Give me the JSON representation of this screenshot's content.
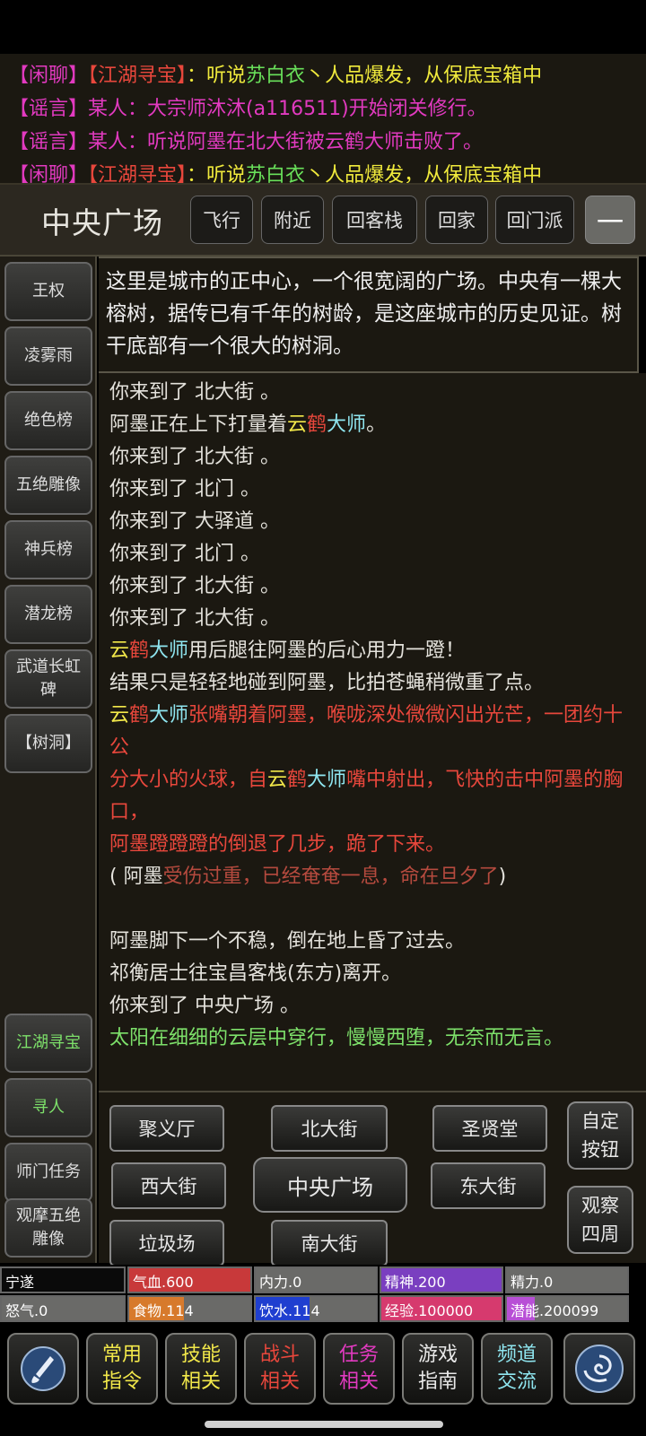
{
  "chat": [
    [
      {
        "t": "【闲聊】",
        "c": "#e23ac0"
      },
      {
        "t": "【江湖寻宝】",
        "c": "#e8473c"
      },
      {
        "t": "：听说",
        "c": "#f0ea3c"
      },
      {
        "t": "苏白衣",
        "c": "#69e05a"
      },
      {
        "t": "丶人品爆发，从保底宝箱中",
        "c": "#f0ea3c"
      }
    ],
    [
      {
        "t": "【谣言】",
        "c": "#e23ac0"
      },
      {
        "t": "某人：大宗师沐沐(a116511)开始闭关修行。",
        "c": "#e23ac0"
      }
    ],
    [
      {
        "t": "【谣言】",
        "c": "#e23ac0"
      },
      {
        "t": "某人：听说阿墨在北大街被云鹤大师击败了。",
        "c": "#e23ac0"
      }
    ],
    [
      {
        "t": "【闲聊】",
        "c": "#e23ac0"
      },
      {
        "t": "【江湖寻宝】",
        "c": "#e8473c"
      },
      {
        "t": "：听说",
        "c": "#f0ea3c"
      },
      {
        "t": "苏白衣",
        "c": "#69e05a"
      },
      {
        "t": "丶人品爆发，从保底宝箱中",
        "c": "#f0ea3c"
      }
    ]
  ],
  "header": {
    "title": "中央广场",
    "buttons": [
      "飞行",
      "附近",
      "回客栈",
      "回家",
      "回门派",
      "一"
    ]
  },
  "sidebar": {
    "items": [
      "王权",
      "凌雾雨",
      "绝色榜",
      "五绝雕像",
      "神兵榜",
      "潜龙榜",
      "武道长虹碑",
      "【树洞】"
    ],
    "bottom_items": [
      {
        "label": "江湖寻宝",
        "color": "#7de06a"
      },
      {
        "label": "寻人",
        "color": "#7de06a"
      },
      {
        "label": "师门任务",
        "color": "#dddddd"
      },
      {
        "label": "观摩五绝雕像",
        "color": "#dddddd"
      }
    ]
  },
  "description": "这里是城市的正中心，一个很宽阔的广场。中央有一棵大榕树，据传已有千年的树龄，是这座城市的历史见证。树干底部有一个很大的树洞。",
  "log": [
    [
      {
        "t": "你来到了 北大街 。"
      }
    ],
    [
      {
        "t": "阿墨正在上下打量着"
      },
      {
        "t": "云",
        "c": "#f2e84a"
      },
      {
        "t": "鹤",
        "c": "#e8473c"
      },
      {
        "t": "大师",
        "c": "#8fe6f0"
      },
      {
        "t": "。"
      }
    ],
    [
      {
        "t": "你来到了 北大街 。"
      }
    ],
    [
      {
        "t": "你来到了 北门 。"
      }
    ],
    [
      {
        "t": "你来到了 大驿道 。"
      }
    ],
    [
      {
        "t": "你来到了 北门 。"
      }
    ],
    [
      {
        "t": "你来到了 北大街 。"
      }
    ],
    [
      {
        "t": "你来到了 北大街 。"
      }
    ],
    [
      {
        "t": "云",
        "c": "#f2e84a"
      },
      {
        "t": "鹤",
        "c": "#e8473c"
      },
      {
        "t": "大师",
        "c": "#8fe6f0"
      },
      {
        "t": "用后腿往阿墨的后心用力一蹬！"
      }
    ],
    [
      {
        "t": "结果只是轻轻地碰到阿墨，比拍苍蝇稍微重了点。"
      }
    ],
    [
      {
        "t": "云",
        "c": "#f2e84a"
      },
      {
        "t": "鹤",
        "c": "#e8473c"
      },
      {
        "t": "大师",
        "c": "#8fe6f0"
      },
      {
        "t": "张嘴朝着阿墨，喉咙深处微微闪出光芒，一团约十公",
        "c": "#e8473c"
      }
    ],
    [
      {
        "t": "分大小的火球，自",
        "c": "#e8473c"
      },
      {
        "t": "云",
        "c": "#f2e84a"
      },
      {
        "t": "鹤",
        "c": "#e8473c"
      },
      {
        "t": "大师",
        "c": "#8fe6f0"
      },
      {
        "t": "嘴中射出，飞快的击中阿墨的胸口，",
        "c": "#e8473c"
      }
    ],
    [
      {
        "t": "阿墨蹬蹬蹬的倒退了几步，跪了下来。",
        "c": "#e8473c"
      }
    ],
    [
      {
        "t": "( 阿墨"
      },
      {
        "t": "受伤过重，已经奄奄一息，命在旦夕了",
        "c": "#b54a3e"
      },
      {
        "t": ")"
      }
    ],
    [
      {
        "t": ""
      }
    ],
    [
      {
        "t": "阿墨脚下一个不稳，倒在地上昏了过去。"
      }
    ],
    [
      {
        "t": "祁衡居士往宝昌客栈(东方)离开。"
      }
    ],
    [
      {
        "t": "你来到了 中央广场 。"
      }
    ],
    [
      {
        "t": "太阳在细细的云层中穿行，慢慢西堕，无奈而无言。",
        "c": "#7de06a"
      }
    ]
  ],
  "map": {
    "northwest": "聚义厅",
    "north": "北大街",
    "northeast": "圣贤堂",
    "west": "西大街",
    "center": "中央广场",
    "east": "东大街",
    "southwest": "垃圾场",
    "south": "南大街",
    "custom": "自定按钮",
    "look": "观察四周"
  },
  "stats": [
    {
      "label": "宁遂",
      "fraction": 1.0,
      "color": "#0a0a0a"
    },
    {
      "label": "气血.600",
      "fraction": 1.0,
      "color": "#c8393a"
    },
    {
      "label": "内力.0",
      "fraction": 0.0,
      "color": "#5a8ad0"
    },
    {
      "label": "精神.200",
      "fraction": 1.0,
      "color": "#7a3fc0"
    },
    {
      "label": "精力.0",
      "fraction": 0.0,
      "color": "#888888"
    },
    {
      "label": "怒气.0",
      "fraction": 0.0,
      "color": "#888888"
    },
    {
      "label": "食物.114",
      "fraction": 0.45,
      "color": "#d77a2c"
    },
    {
      "label": "饮水.114",
      "fraction": 0.45,
      "color": "#1f3fd0"
    },
    {
      "label": "经验.100000",
      "fraction": 1.0,
      "color": "#d63a6e"
    },
    {
      "label": "潜能.200099",
      "fraction": 0.23,
      "color": "#b84fd6"
    }
  ],
  "bottom_nav": [
    {
      "label": "",
      "icon": "brush-icon"
    },
    {
      "label": "常用指令",
      "color": "#f2e84a"
    },
    {
      "label": "技能相关",
      "color": "#f2e84a"
    },
    {
      "label": "战斗相关",
      "color": "#e8473c"
    },
    {
      "label": "任务相关",
      "color": "#e23ac0"
    },
    {
      "label": "游戏指南",
      "color": "#e8e8e8"
    },
    {
      "label": "频道交流",
      "color": "#8fe6f0"
    },
    {
      "label": "",
      "icon": "swirl-icon"
    }
  ]
}
